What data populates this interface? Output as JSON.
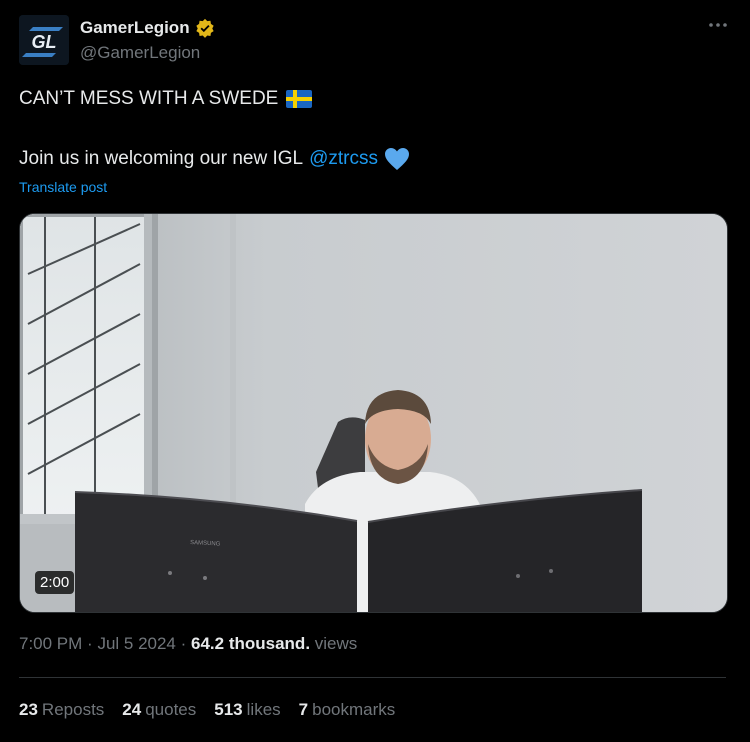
{
  "author": {
    "display_name": "GamerLegion",
    "handle": "@GamerLegion",
    "avatar_text": "GL"
  },
  "post": {
    "line1": "CAN’T MESS WITH A SWEDE",
    "line2_prefix": "Join us in welcoming our new IGL",
    "mention": "@ztrcss",
    "translate": "Translate post"
  },
  "video": {
    "duration": "2:00",
    "monitor_brand": "SAMSUNG"
  },
  "meta": {
    "time": "7:00 PM",
    "date": "Jul 5 2024",
    "views_count": "64.2 thousand.",
    "views_label": "views"
  },
  "stats": {
    "reposts_count": "23",
    "reposts_label": "Reposts",
    "quotes_count": "24",
    "quotes_label": "quotes",
    "likes_count": "513",
    "likes_label": "likes",
    "bookmarks_count": "7",
    "bookmarks_label": "bookmarks"
  },
  "icons": {
    "verified": "verified-gold-badge-icon",
    "more": "more-options-icon",
    "flag": "sweden-flag-icon",
    "heart": "blue-heart-icon"
  },
  "colors": {
    "background": "#000000",
    "text": "#e7e9ea",
    "secondary": "#71767b",
    "link": "#1d9bf0",
    "verified": "#e2b719"
  }
}
